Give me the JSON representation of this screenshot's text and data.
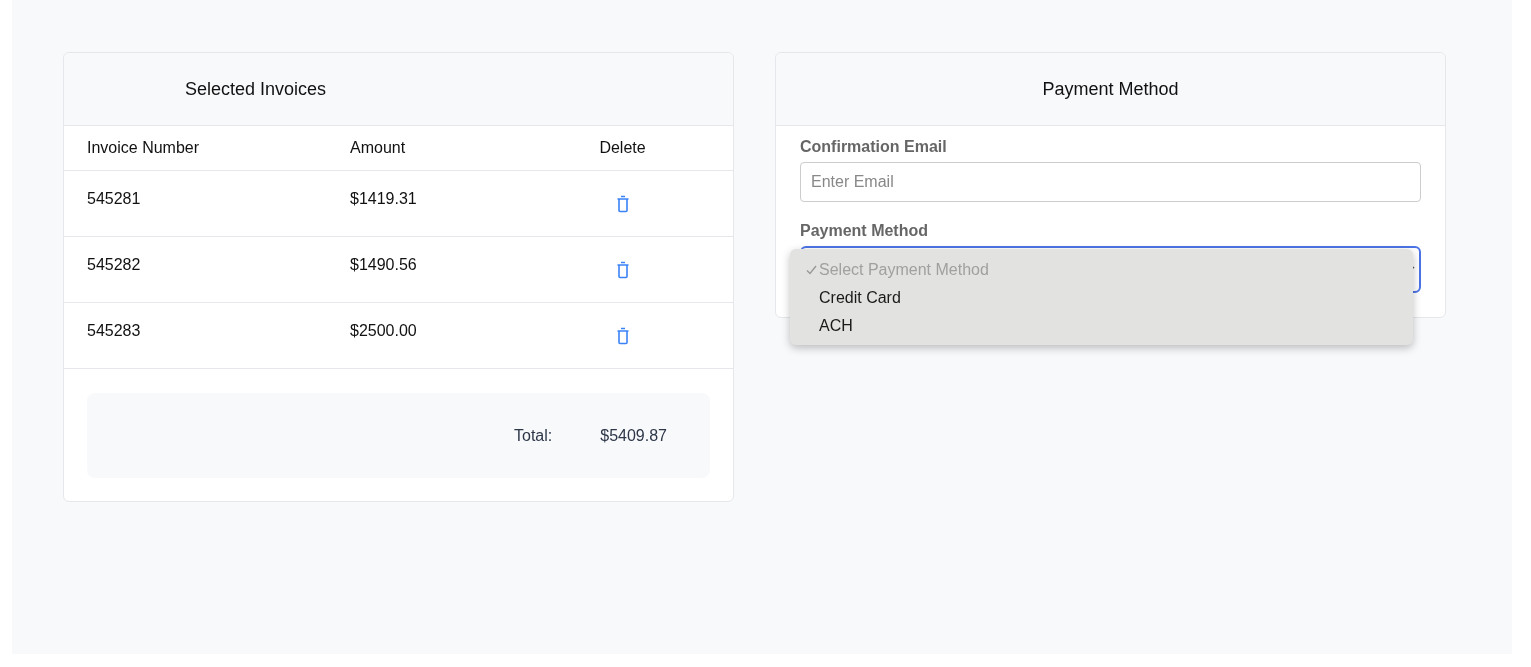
{
  "invoices": {
    "title": "Selected Invoices",
    "columns": [
      "Invoice Number",
      "Amount",
      "Delete"
    ],
    "rows": [
      {
        "number": "545281",
        "amount": "$1419.31"
      },
      {
        "number": "545282",
        "amount": "$1490.56"
      },
      {
        "number": "545283",
        "amount": "$2500.00"
      }
    ],
    "total_label": "Total:",
    "total_value": "$5409.87"
  },
  "payment": {
    "title": "Payment Method",
    "email": {
      "label": "Confirmation Email",
      "placeholder": "Enter Email"
    },
    "method": {
      "label": "Payment Method",
      "focused": true,
      "expanded": true,
      "options": [
        {
          "label": "Select Payment Method",
          "selected": true,
          "disabled": true
        },
        {
          "label": "Credit Card",
          "selected": false,
          "disabled": false
        },
        {
          "label": "ACH",
          "selected": false,
          "disabled": false
        }
      ]
    }
  }
}
